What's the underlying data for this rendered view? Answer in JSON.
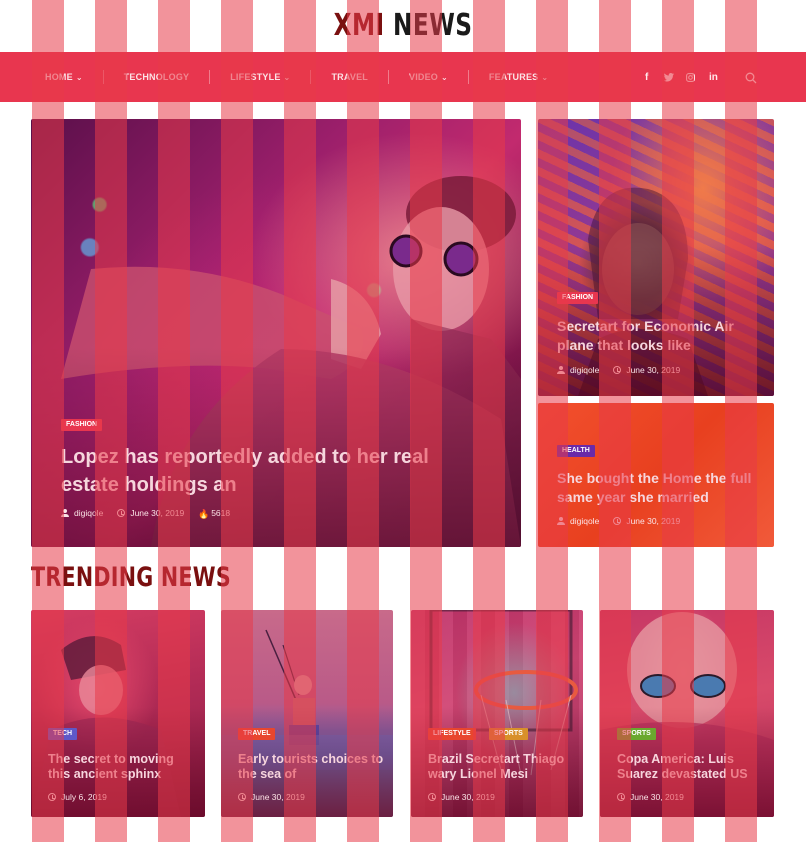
{
  "site": {
    "logo_part1": "XMI",
    "logo_part2": "NEWS"
  },
  "nav": {
    "items": [
      {
        "label": "HOME",
        "has_dropdown": true
      },
      {
        "label": "TECHNOLOGY",
        "has_dropdown": false
      },
      {
        "label": "LIFESTYLE",
        "has_dropdown": true
      },
      {
        "label": "TRAVEL",
        "has_dropdown": false
      },
      {
        "label": "VIDEO",
        "has_dropdown": true
      },
      {
        "label": "FEATURES",
        "has_dropdown": true
      }
    ],
    "social": {
      "facebook": "f",
      "twitter": "twitter-icon",
      "instagram": "instagram-icon",
      "linkedin": "in"
    },
    "search_icon": "search-icon",
    "chevron": "⌄"
  },
  "hero": {
    "main": {
      "tag": "FASHION",
      "tag_color": "#e8364f",
      "title": "Lopez has reportedly added to her real estate holdings an",
      "author": "digiqole",
      "date": "June 30, 2019",
      "views": "5618"
    },
    "side1": {
      "tag": "FASHION",
      "tag_color": "#e8364f",
      "title": "Secretart for Economic Air plane that looks like",
      "author": "digiqole",
      "date": "June 30, 2019"
    },
    "side2": {
      "tag": "HEALTH",
      "tag_color": "#6a2aa8",
      "title": "She bought the Home the full same year she married",
      "author": "digiqole",
      "date": "June 30, 2019"
    }
  },
  "trending": {
    "heading": "TRENDING NEWS",
    "cards": [
      {
        "tags": [
          {
            "label": "TECH",
            "color": "#5e58c8"
          }
        ],
        "title": "The secret to moving this ancient sphinx",
        "date": "July 6, 2019"
      },
      {
        "tags": [
          {
            "label": "TRAVEL",
            "color": "#e8462e"
          }
        ],
        "title": "Early tourists choices to the sea of",
        "date": "June 30, 2019"
      },
      {
        "tags": [
          {
            "label": "LIFESTYLE",
            "color": "#e8462e"
          },
          {
            "label": "SPORTS",
            "color": "#d8902a"
          }
        ],
        "title": "Brazil Secretart Thiago wary Lionel Mesi",
        "date": "June 30, 2019"
      },
      {
        "tags": [
          {
            "label": "SPORTS",
            "color": "#6aa82e"
          }
        ],
        "title": "Copa America: Luis Suarez devastated US",
        "date": "June 30, 2019"
      }
    ]
  }
}
